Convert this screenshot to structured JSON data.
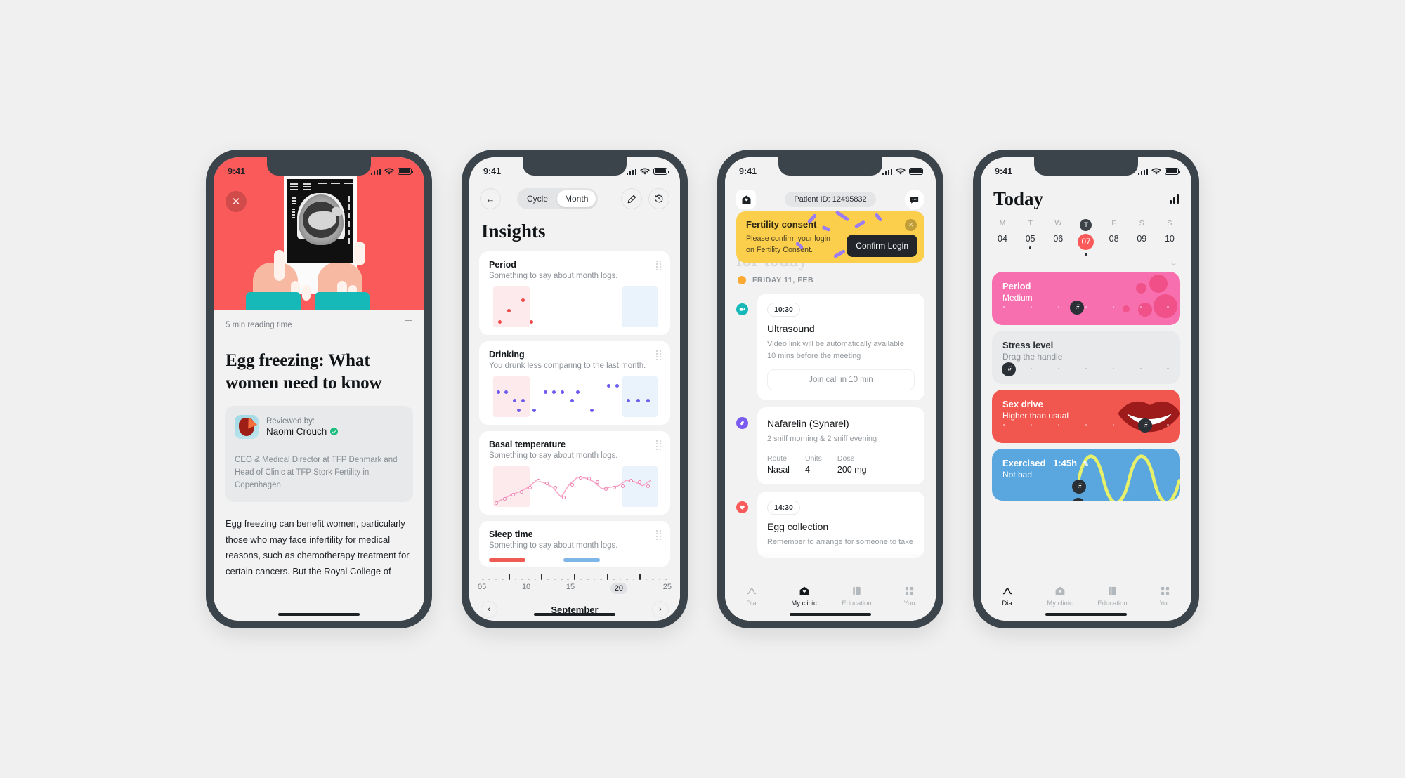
{
  "statusbar": {
    "time": "9:41"
  },
  "phone1": {
    "name": "article-screen",
    "close_icon": "close-icon",
    "hero_image_alt": "ultrasound-scan-illustration",
    "reading_time": "5 min reading time",
    "bookmark_icon": "bookmark-icon",
    "title": "Egg freezing: What women need to know",
    "reviewer": {
      "label": "Reviewed by:",
      "name": "Naomi Crouch",
      "verified_icon": "verified-badge-icon",
      "description": "CEO & Medical Director at TFP Denmark and Head of Clinic at TFP Stork Fertility in Copenhagen."
    },
    "paragraph": "Egg freezing can benefit women, particularly those who may face infertility for medical reasons, such as chemotherapy treatment for certain cancers. But the Royal College of"
  },
  "phone2": {
    "name": "insights-screen",
    "back_icon": "back-arrow-icon",
    "segmented": {
      "options": [
        "Cycle",
        "Month"
      ],
      "selected": "Month"
    },
    "edit_icon": "pencil-icon",
    "history_icon": "history-clock-icon",
    "title": "Insights",
    "cards": [
      {
        "title": "Period",
        "subtitle": "Something to say about month logs.",
        "chart": "scatter-red"
      },
      {
        "title": "Drinking",
        "subtitle": "You drunk less comparing to the last month.",
        "chart": "scatter-purple"
      },
      {
        "title": "Basal temperature",
        "subtitle": "Something to say about month logs.",
        "chart": "line-pink"
      },
      {
        "title": "Sleep time",
        "subtitle": "Something to say about month logs.",
        "chart": "bars"
      }
    ],
    "axis": {
      "ticks": [
        "05",
        "10",
        "15",
        "20",
        "25"
      ],
      "current": "20"
    },
    "month": "September",
    "prev_icon": "chevron-left-icon",
    "next_icon": "chevron-right-icon"
  },
  "phone3": {
    "name": "my-clinic-screen",
    "home_icon": "clinic-home-icon",
    "patient_id": "Patient ID: 12495832",
    "chat_icon": "chat-bubble-icon",
    "banner": {
      "title": "Fertility consent",
      "text": "Please confirm your login on Fertility Consent.",
      "cta": "Confirm Login",
      "close_icon": "close-icon"
    },
    "ghost_heading": "for today",
    "date_label": "FRIDAY 11, FEB",
    "timeline": [
      {
        "time": "10:30",
        "title": "Ultrasound",
        "desc": "Video link will be automatically available 10 mins before the meeting",
        "action": "Join call in 10 min",
        "icon": "video-camera-icon",
        "color": "#17b8b8"
      },
      {
        "time": "",
        "title": "Nafarelin (Synarel)",
        "desc": "2 sniff morning & 2 sniff evening",
        "icon": "pill-icon",
        "color": "#7a5cf0",
        "meta": [
          {
            "key": "Route",
            "value": "Nasal"
          },
          {
            "key": "Units",
            "value": "4"
          },
          {
            "key": "Dose",
            "value": "200 mg"
          }
        ]
      },
      {
        "time": "14:30",
        "title": "Egg collection",
        "desc": "Remember to arrange for someone to take",
        "icon": "heart-icon",
        "color": "#fa5a5a"
      }
    ],
    "nav": [
      {
        "label": "Dia",
        "icon": "wave-icon",
        "active": false
      },
      {
        "label": "My clinic",
        "icon": "clinic-home-icon",
        "active": true
      },
      {
        "label": "Education",
        "icon": "book-icon",
        "active": false
      },
      {
        "label": "You",
        "icon": "grid-icon",
        "active": false
      }
    ]
  },
  "phone4": {
    "name": "today-screen",
    "title": "Today",
    "stats_icon": "bar-chart-icon",
    "weekdays": [
      {
        "letter": "M",
        "num": "04",
        "dot": false,
        "selected": false
      },
      {
        "letter": "T",
        "num": "05",
        "dot": true,
        "selected": false
      },
      {
        "letter": "W",
        "num": "06",
        "dot": false,
        "selected": false
      },
      {
        "letter": "T",
        "num": "07",
        "dot": true,
        "selected": true
      },
      {
        "letter": "F",
        "num": "08",
        "dot": false,
        "selected": false
      },
      {
        "letter": "S",
        "num": "09",
        "dot": false,
        "selected": false
      },
      {
        "letter": "S",
        "num": "10",
        "dot": false,
        "selected": false
      }
    ],
    "expand_icon": "chevron-down-icon",
    "tiles": [
      {
        "title": "Period",
        "value": "Medium",
        "bg": "#f76fae",
        "fg": "#ffffff",
        "kind": "blobs"
      },
      {
        "title": "Stress level",
        "value": "Drag the handle",
        "bg": "#e9eaec",
        "fg": "#2b3036",
        "kind": "slider"
      },
      {
        "title": "Sex drive",
        "value": "Higher than usual",
        "bg": "#f2574f",
        "fg": "#ffffff",
        "kind": "lips"
      },
      {
        "title": "Exercised",
        "value": "Not bad",
        "bg": "#5aa7e0",
        "fg": "#ffffff",
        "kind": "wave",
        "badge": "1:45h",
        "edit_icon": "pencil-icon"
      }
    ],
    "nav": [
      {
        "label": "Dia",
        "icon": "wave-icon",
        "active": true
      },
      {
        "label": "My clinic",
        "icon": "clinic-home-icon",
        "active": false
      },
      {
        "label": "Education",
        "icon": "book-icon",
        "active": false
      },
      {
        "label": "You",
        "icon": "grid-icon",
        "active": false
      }
    ]
  }
}
